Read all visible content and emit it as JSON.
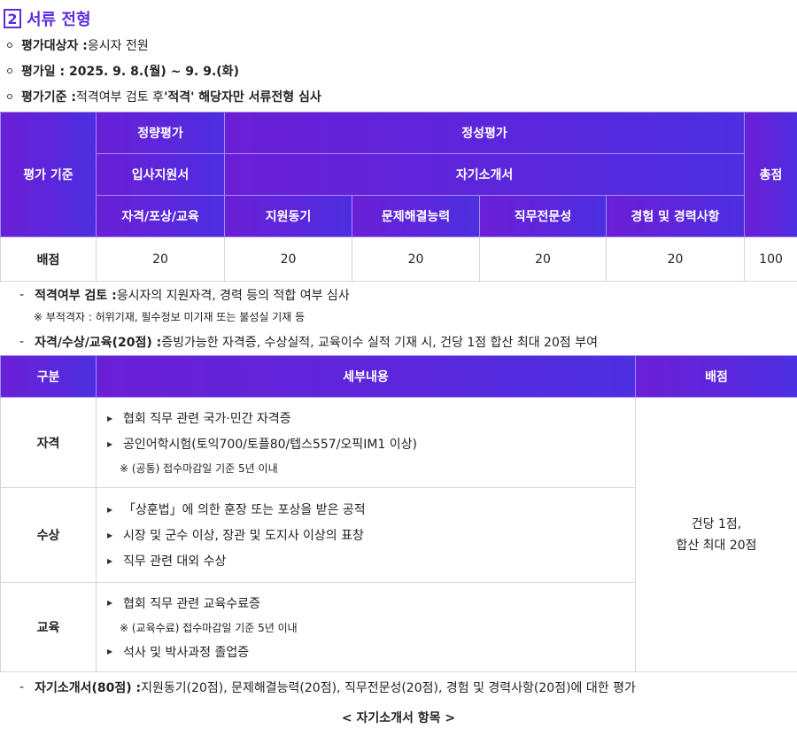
{
  "section": {
    "number": "2",
    "title": "서류 전형"
  },
  "bullets": [
    {
      "label": "평가대상자 :",
      "text": " 응시자 전원"
    },
    {
      "label": "평가일 : 2025. 9. 8.(월) ~ 9. 9.(화)",
      "text": ""
    },
    {
      "label": "평가기준 :",
      "text": " 적격여부 검토 후 ",
      "emph": "'적격' 해당자만 서류전형 심사"
    }
  ],
  "table1": {
    "criteria": "평가 기준",
    "quant": "정량평가",
    "qual": "정성평가",
    "application": "입사지원서",
    "self_intro": "자기소개서",
    "total": "총점",
    "cols": [
      "자격/포상/교육",
      "지원동기",
      "문제해결능력",
      "직무전문성",
      "경험 및 경력사항"
    ],
    "score_label": "배점",
    "scores": [
      "20",
      "20",
      "20",
      "20",
      "20",
      "100"
    ]
  },
  "notes": {
    "eligibility_label": "적격여부 검토 :",
    "eligibility_text": " 응시자의 지원자격, 경력 등의 적합 여부 심사",
    "ineligible": "※  부적격자 : 허위기재, 필수정보 미기재 또는 불성실 기재 등",
    "qual_label": "자격/수상/교육(20점) :",
    "qual_text": " 증빙가능한 자격증, 수상실적, 교육이수 실적 기재 시, 건당 1점 합산 최대 20점 부여"
  },
  "table2": {
    "headers": [
      "구분",
      "세부내용",
      "배점"
    ],
    "score_line1": "건당 1점,",
    "score_line2": "합산 최대 20점",
    "rows": [
      {
        "category": "자격",
        "items": [
          "협회 직무 관련 국가·민간 자격증",
          "공인어학시험(토익700/토플80/텝스557/오픽IM1 이상)"
        ],
        "note": "※  (공통) 접수마감일 기준 5년 이내"
      },
      {
        "category": "수상",
        "items": [
          "「상훈법」에 의한 훈장 또는 포상을 받은 공적",
          "시장 및 군수 이상, 장관 및 도지사 이상의 표창",
          "직무 관련 대외 수상"
        ]
      },
      {
        "category": "교육",
        "items": [
          "협회 직무 관련 교육수료증"
        ],
        "note": "※  (교육수료) 접수마감일 기준 5년 이내",
        "items2": [
          "석사 및 박사과정 졸업증"
        ]
      }
    ]
  },
  "self_intro_note": {
    "label": "자기소개서(80점) :",
    "text": " 지원동기(20점), 문제해결능력(20점), 직무전문성(20점), 경험 및 경력사항(20점)에 대한 평가"
  },
  "footer": "< 자기소개서 항목 >"
}
